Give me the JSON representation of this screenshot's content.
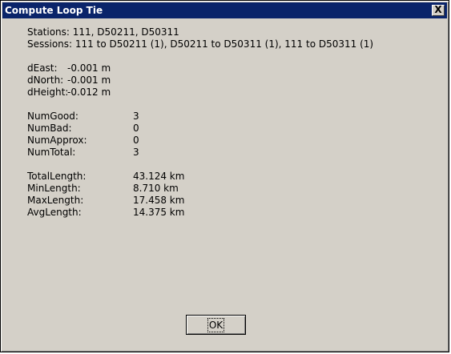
{
  "window": {
    "title": "Compute Loop Tie",
    "close_glyph": "X"
  },
  "info": {
    "stations": "Stations: 111, D50211, D50311",
    "sessions": "Sessions: 111 to D50211 (1), D50211 to D50311 (1), 111 to D50311 (1)"
  },
  "deltas": [
    {
      "label": "dEast:",
      "value": "-0.001 m"
    },
    {
      "label": "dNorth:",
      "value": "-0.001 m"
    },
    {
      "label": "dHeight:",
      "value": "-0.012 m"
    }
  ],
  "counts": [
    {
      "label": "NumGood:",
      "value": "3"
    },
    {
      "label": "NumBad:",
      "value": "0"
    },
    {
      "label": "NumApprox:",
      "value": "0"
    },
    {
      "label": "NumTotal:",
      "value": "3"
    }
  ],
  "lengths": [
    {
      "label": "TotalLength:",
      "value": "43.124 km"
    },
    {
      "label": "MinLength:",
      "value": "8.710 km"
    },
    {
      "label": "MaxLength:",
      "value": "17.458 km"
    },
    {
      "label": "AvgLength:",
      "value": "14.375 km"
    }
  ],
  "buttons": {
    "ok_label": "OK"
  },
  "colors": {
    "titlebar": "#0a246a",
    "face": "#d4d0c8"
  }
}
